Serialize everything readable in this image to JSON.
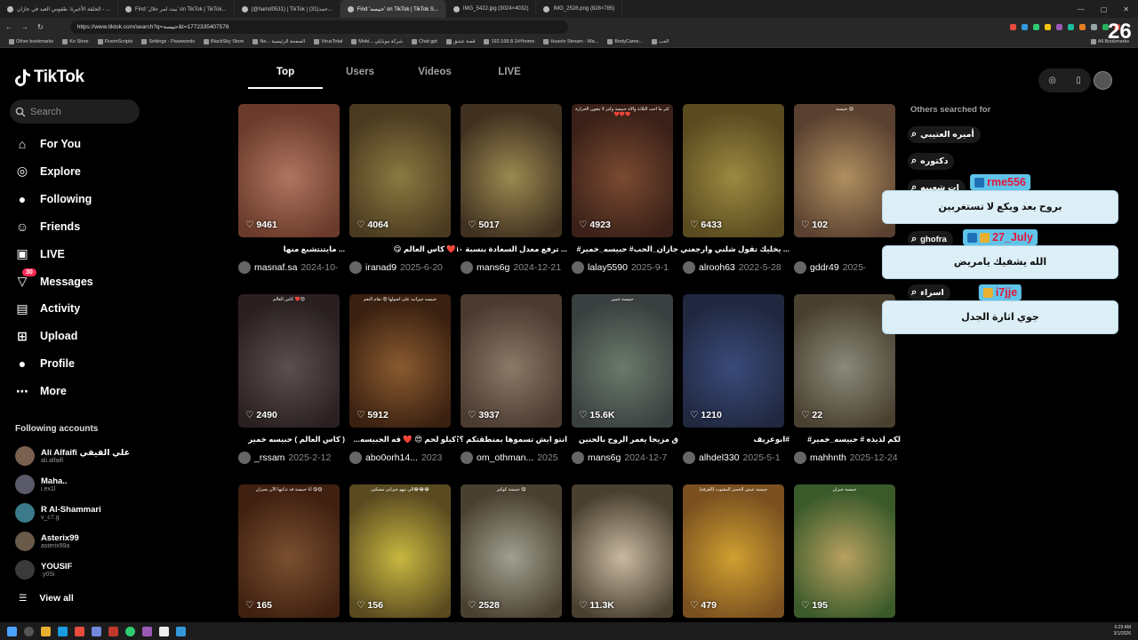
{
  "browser": {
    "tabs": [
      {
        "label": "الحلقة الأخيرة: طقوس العيد في جازان - ..."
      },
      {
        "label": "Find 'بيت لمر حلال' on TikTok | TikTok..."
      },
      {
        "label": "(@hamd0531) | TikTok | حمد(31)..."
      },
      {
        "label": "Find 'حبيسه' on TikTok | TikTok S..."
      },
      {
        "label": "IMG_5422.jpg (3024×4032)"
      },
      {
        "label": "IMG_2528.png (828×785)"
      }
    ],
    "url": "https://www.tiktok.com/search?q=حبيسه&t=1772335407578",
    "bookmarks": [
      "Other bookmarks",
      "Ko Store",
      "FivemScripts",
      "Settings - Passwords",
      "BlackSky Store",
      "Ne... الصفحة الرئيسية",
      "VirusTotal",
      "Mobi... شركة موبايلي",
      "Chat gpt",
      "قصة عشق",
      "192.168.8.1/#/home",
      "Husein Stream - Wa...",
      "BodyCame...",
      "العب"
    ],
    "bookmarks_right": "All Bookmarks"
  },
  "tiktok": {
    "logo": "TikTok",
    "search_placeholder": "Search",
    "nav": [
      {
        "label": "For You",
        "icon": "home-icon"
      },
      {
        "label": "Explore",
        "icon": "compass-icon"
      },
      {
        "label": "Following",
        "icon": "following-icon"
      },
      {
        "label": "Friends",
        "icon": "friends-icon"
      },
      {
        "label": "LIVE",
        "icon": "live-icon"
      },
      {
        "label": "Messages",
        "icon": "messages-icon",
        "badge": "30"
      },
      {
        "label": "Activity",
        "icon": "activity-icon"
      },
      {
        "label": "Upload",
        "icon": "upload-icon"
      },
      {
        "label": "Profile",
        "icon": "profile-icon"
      },
      {
        "label": "More",
        "icon": "more-icon"
      }
    ],
    "following_title": "Following accounts",
    "following": [
      {
        "name": "Ali Alfaifi علي الفيفي",
        "handle": "ali.alfaifi"
      },
      {
        "name": "Maha..",
        "handle": "i.ex1l"
      },
      {
        "name": "R Al-Shammari",
        "handle": "v_c7.g"
      },
      {
        "name": "Asterix99",
        "handle": "asterix99a"
      },
      {
        "name": "YOUSIF",
        "handle": ".y0Si"
      }
    ],
    "view_all": "View all",
    "search_tabs": [
      "Top",
      "Users",
      "Videos",
      "LIVE"
    ],
    "others_title": "Others searched for",
    "related": [
      "أميره العتيبي",
      "دكتوره",
      "ات شعبيه",
      "ghofra",
      "اسراء"
    ],
    "videos": [
      {
        "views": "9461",
        "caption": "",
        "desc": "... مايتنتشبع منها",
        "user": "masnaf.sa",
        "date": "2024-10-",
        "c1": "#b07560",
        "c2": "#6a3a2a"
      },
      {
        "views": "4064",
        "caption": "",
        "desc": "❤️ كاس العالم 😋",
        "user": "iranad9",
        "date": "2025-6-20",
        "c1": "#8a7a40",
        "c2": "#4a3a20"
      },
      {
        "views": "5017",
        "caption": "",
        "desc": "... ترفع معدل السعادة بنسبة ٩٠",
        "user": "mans6g",
        "date": "2024-12-21",
        "c1": "#9a8a50",
        "c2": "#403020"
      },
      {
        "views": "4923",
        "caption": "كثر ما احب الثلاثة والاه حبيسة وكبز لا تبغون الحرارة ❤️❤️❤️",
        "desc": "جازان_الحب# حبيسه_خمير#",
        "user": "lalay5590",
        "date": "2025-9-1",
        "c1": "#7a4a30",
        "c2": "#3a2018"
      },
      {
        "views": "6433",
        "caption": "",
        "desc": "... يخليك تقول شلني وارجعني",
        "user": "alrooh63",
        "date": "2022-5-28",
        "c1": "#9a8a40",
        "c2": "#5a4a20"
      },
      {
        "views": "102",
        "caption": "حبيسة 😋",
        "desc": "",
        "user": "gddr49",
        "date": "2025-",
        "c1": "#b09060",
        "c2": "#5a4030"
      },
      {
        "views": "2490",
        "caption": "كاس العالم ❤️😍",
        "desc": "( كاس العالم ) حبيسه خمير",
        "user": "_rssam",
        "date": "2025-2-12",
        "c1": "#5a5050",
        "c2": "#2a2020"
      },
      {
        "views": "5912",
        "caption": "حبيسه جيزانيه على اصولها 😍 تقام النعم",
        "desc": "كيلو لحم 😍 ❤️ قه الحبيسه...",
        "user": "abo0orh14...",
        "date": "2023",
        "c1": "#8a5a30",
        "c2": "#3a2010"
      },
      {
        "views": "3937",
        "caption": "",
        "desc": "انتو ايش تسموها بمنطقتكم ؟؟",
        "user": "om_othman...",
        "date": "2025",
        "c1": "#8a7a68",
        "c2": "#4a3a30"
      },
      {
        "views": "15.6K",
        "caption": "حبيسة خمير",
        "desc": "ق مزيجا يغمر الروح بالحنين",
        "user": "mans6g",
        "date": "2024-12-7",
        "c1": "#6a7a6a",
        "c2": "#3a4040"
      },
      {
        "views": "1210",
        "caption": "",
        "desc": "#ابوعريف",
        "user": "alhdel330",
        "date": "2025-5-1",
        "c1": "#3a4a7a",
        "c2": "#202840"
      },
      {
        "views": "22",
        "caption": "",
        "desc": "لكم لذيذه # حبيسه_خمير#",
        "user": "mahhnth",
        "date": "2025-12-24",
        "c1": "#8a8a7a",
        "c2": "#4a4030"
      },
      {
        "views": "165",
        "caption": "أنا حبيسة قد تذكيها الآن بجيزان 😋😋",
        "desc": "",
        "user": "",
        "date": "",
        "c1": "#7a5030",
        "c2": "#402010"
      },
      {
        "views": "156",
        "caption": "الي مهو جيزاني مسكين😂😂😂",
        "desc": "",
        "user": "",
        "date": "",
        "c1": "#c8b840",
        "c2": "#5a4a20"
      },
      {
        "views": "2528",
        "caption": "حبيسة كوكيز 😋",
        "desc": "",
        "user": "",
        "date": "",
        "c1": "#a0a090",
        "c2": "#4a4030"
      },
      {
        "views": "11.3K",
        "caption": "",
        "desc": "",
        "user": "",
        "date": "",
        "c1": "#c8b8a0",
        "c2": "#4a4030"
      },
      {
        "views": "479",
        "caption": "حبيسة عيش الخمير المفتوت (الفرقة)",
        "desc": "",
        "user": "",
        "date": "",
        "c1": "#d0a030",
        "c2": "#7a5020"
      },
      {
        "views": "195",
        "caption": "حبيسة جيزان",
        "desc": "",
        "user": "",
        "date": "",
        "c1": "#b8a060",
        "c2": "#3a5a2a"
      }
    ]
  },
  "overlay": {
    "chats": [
      {
        "user": "rme556",
        "msg": "بروح بعد ويكع لا تستغربين"
      },
      {
        "user": "27_July",
        "msg": "الله يشفيك يامريض"
      },
      {
        "user": "i7jje",
        "msg": "جوي اثارة الجدل"
      }
    ],
    "viewer_count": "26"
  },
  "taskbar": {
    "time": "6:29 AM",
    "date": "3/1/2026"
  }
}
